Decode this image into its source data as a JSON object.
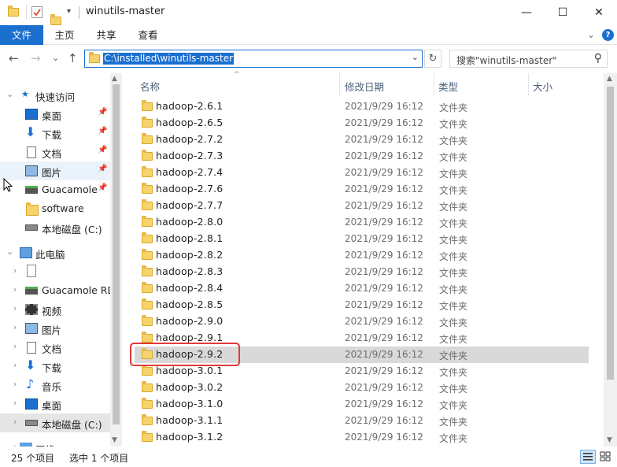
{
  "title": {
    "text": "winutils-master",
    "quick_access_icons": [
      "folder-icon",
      "properties-check-icon",
      "new-folder-icon",
      "quick-access-dropdown-icon"
    ],
    "controls": {
      "minimize": "—",
      "maximize": "☐",
      "close": "✕"
    }
  },
  "ribbon": {
    "tabs": [
      "文件",
      "主页",
      "共享",
      "查看"
    ],
    "expand_glyph": "⌄",
    "help_glyph": "?"
  },
  "address": {
    "back_glyph": "←",
    "forward_glyph": "→",
    "recent_glyph": "⌄",
    "up_glyph": "↑",
    "path": "C:\\installed\\winutils-master",
    "dropdown_glyph": "⌄",
    "refresh_glyph": "↻",
    "search_placeholder": "搜索\"winutils-master\"",
    "search_glyph": "⚲"
  },
  "nav": {
    "quick_access": "快速访问",
    "pinned": [
      {
        "label": "桌面",
        "icon": "desktop-icon"
      },
      {
        "label": "下载",
        "icon": "download-icon"
      },
      {
        "label": "文档",
        "icon": "document-icon"
      },
      {
        "label": "图片",
        "icon": "pictures-icon"
      },
      {
        "label": "Guacamole",
        "icon": "network-drive-icon"
      }
    ],
    "unpinned": [
      {
        "label": "software",
        "icon": "folder-icon"
      },
      {
        "label": "本地磁盘 (C:)",
        "icon": "drive-icon"
      }
    ],
    "this_pc": "此电脑",
    "pc_items": [
      {
        "label": "",
        "icon": "blank-file-icon"
      },
      {
        "label": "Guacamole RD",
        "icon": "network-drive-icon"
      },
      {
        "label": "视频",
        "icon": "video-icon"
      },
      {
        "label": "图片",
        "icon": "pictures-icon"
      },
      {
        "label": "文档",
        "icon": "document-icon"
      },
      {
        "label": "下载",
        "icon": "download-icon"
      },
      {
        "label": "音乐",
        "icon": "music-icon"
      },
      {
        "label": "桌面",
        "icon": "desktop-icon"
      },
      {
        "label": "本地磁盘 (C:)",
        "icon": "drive-icon"
      }
    ],
    "network": "网络",
    "pin_glyph": "📌",
    "expanded_glyph": "⌄",
    "collapsed_glyph": "›",
    "star_glyph": "★"
  },
  "columns": {
    "name": "名称",
    "modified": "修改日期",
    "type": "类型",
    "size": "大小",
    "sort_glyph": "^"
  },
  "files": [
    {
      "name": "hadoop-2.6.1",
      "date": "2021/9/29 16:12",
      "type": "文件夹"
    },
    {
      "name": "hadoop-2.6.5",
      "date": "2021/9/29 16:12",
      "type": "文件夹"
    },
    {
      "name": "hadoop-2.7.2",
      "date": "2021/9/29 16:12",
      "type": "文件夹"
    },
    {
      "name": "hadoop-2.7.3",
      "date": "2021/9/29 16:12",
      "type": "文件夹"
    },
    {
      "name": "hadoop-2.7.4",
      "date": "2021/9/29 16:12",
      "type": "文件夹"
    },
    {
      "name": "hadoop-2.7.6",
      "date": "2021/9/29 16:12",
      "type": "文件夹"
    },
    {
      "name": "hadoop-2.7.7",
      "date": "2021/9/29 16:12",
      "type": "文件夹"
    },
    {
      "name": "hadoop-2.8.0",
      "date": "2021/9/29 16:12",
      "type": "文件夹"
    },
    {
      "name": "hadoop-2.8.1",
      "date": "2021/9/29 16:12",
      "type": "文件夹"
    },
    {
      "name": "hadoop-2.8.2",
      "date": "2021/9/29 16:12",
      "type": "文件夹"
    },
    {
      "name": "hadoop-2.8.3",
      "date": "2021/9/29 16:12",
      "type": "文件夹"
    },
    {
      "name": "hadoop-2.8.4",
      "date": "2021/9/29 16:12",
      "type": "文件夹"
    },
    {
      "name": "hadoop-2.8.5",
      "date": "2021/9/29 16:12",
      "type": "文件夹"
    },
    {
      "name": "hadoop-2.9.0",
      "date": "2021/9/29 16:12",
      "type": "文件夹"
    },
    {
      "name": "hadoop-2.9.1",
      "date": "2021/9/29 16:12",
      "type": "文件夹"
    },
    {
      "name": "hadoop-2.9.2",
      "date": "2021/9/29 16:12",
      "type": "文件夹",
      "selected": true
    },
    {
      "name": "hadoop-3.0.1",
      "date": "2021/9/29 16:12",
      "type": "文件夹"
    },
    {
      "name": "hadoop-3.0.2",
      "date": "2021/9/29 16:12",
      "type": "文件夹"
    },
    {
      "name": "hadoop-3.1.0",
      "date": "2021/9/29 16:12",
      "type": "文件夹"
    },
    {
      "name": "hadoop-3.1.1",
      "date": "2021/9/29 16:12",
      "type": "文件夹"
    },
    {
      "name": "hadoop-3.1.2",
      "date": "2021/9/29 16:12",
      "type": "文件夹"
    }
  ],
  "status": {
    "count": "25 个项目",
    "selected": "选中 1 个项目"
  },
  "colors": {
    "accent": "#1a6fcf",
    "folder": "#f6d36b",
    "annotation": "#e03a3a",
    "selected_row": "#d9d9d9"
  }
}
